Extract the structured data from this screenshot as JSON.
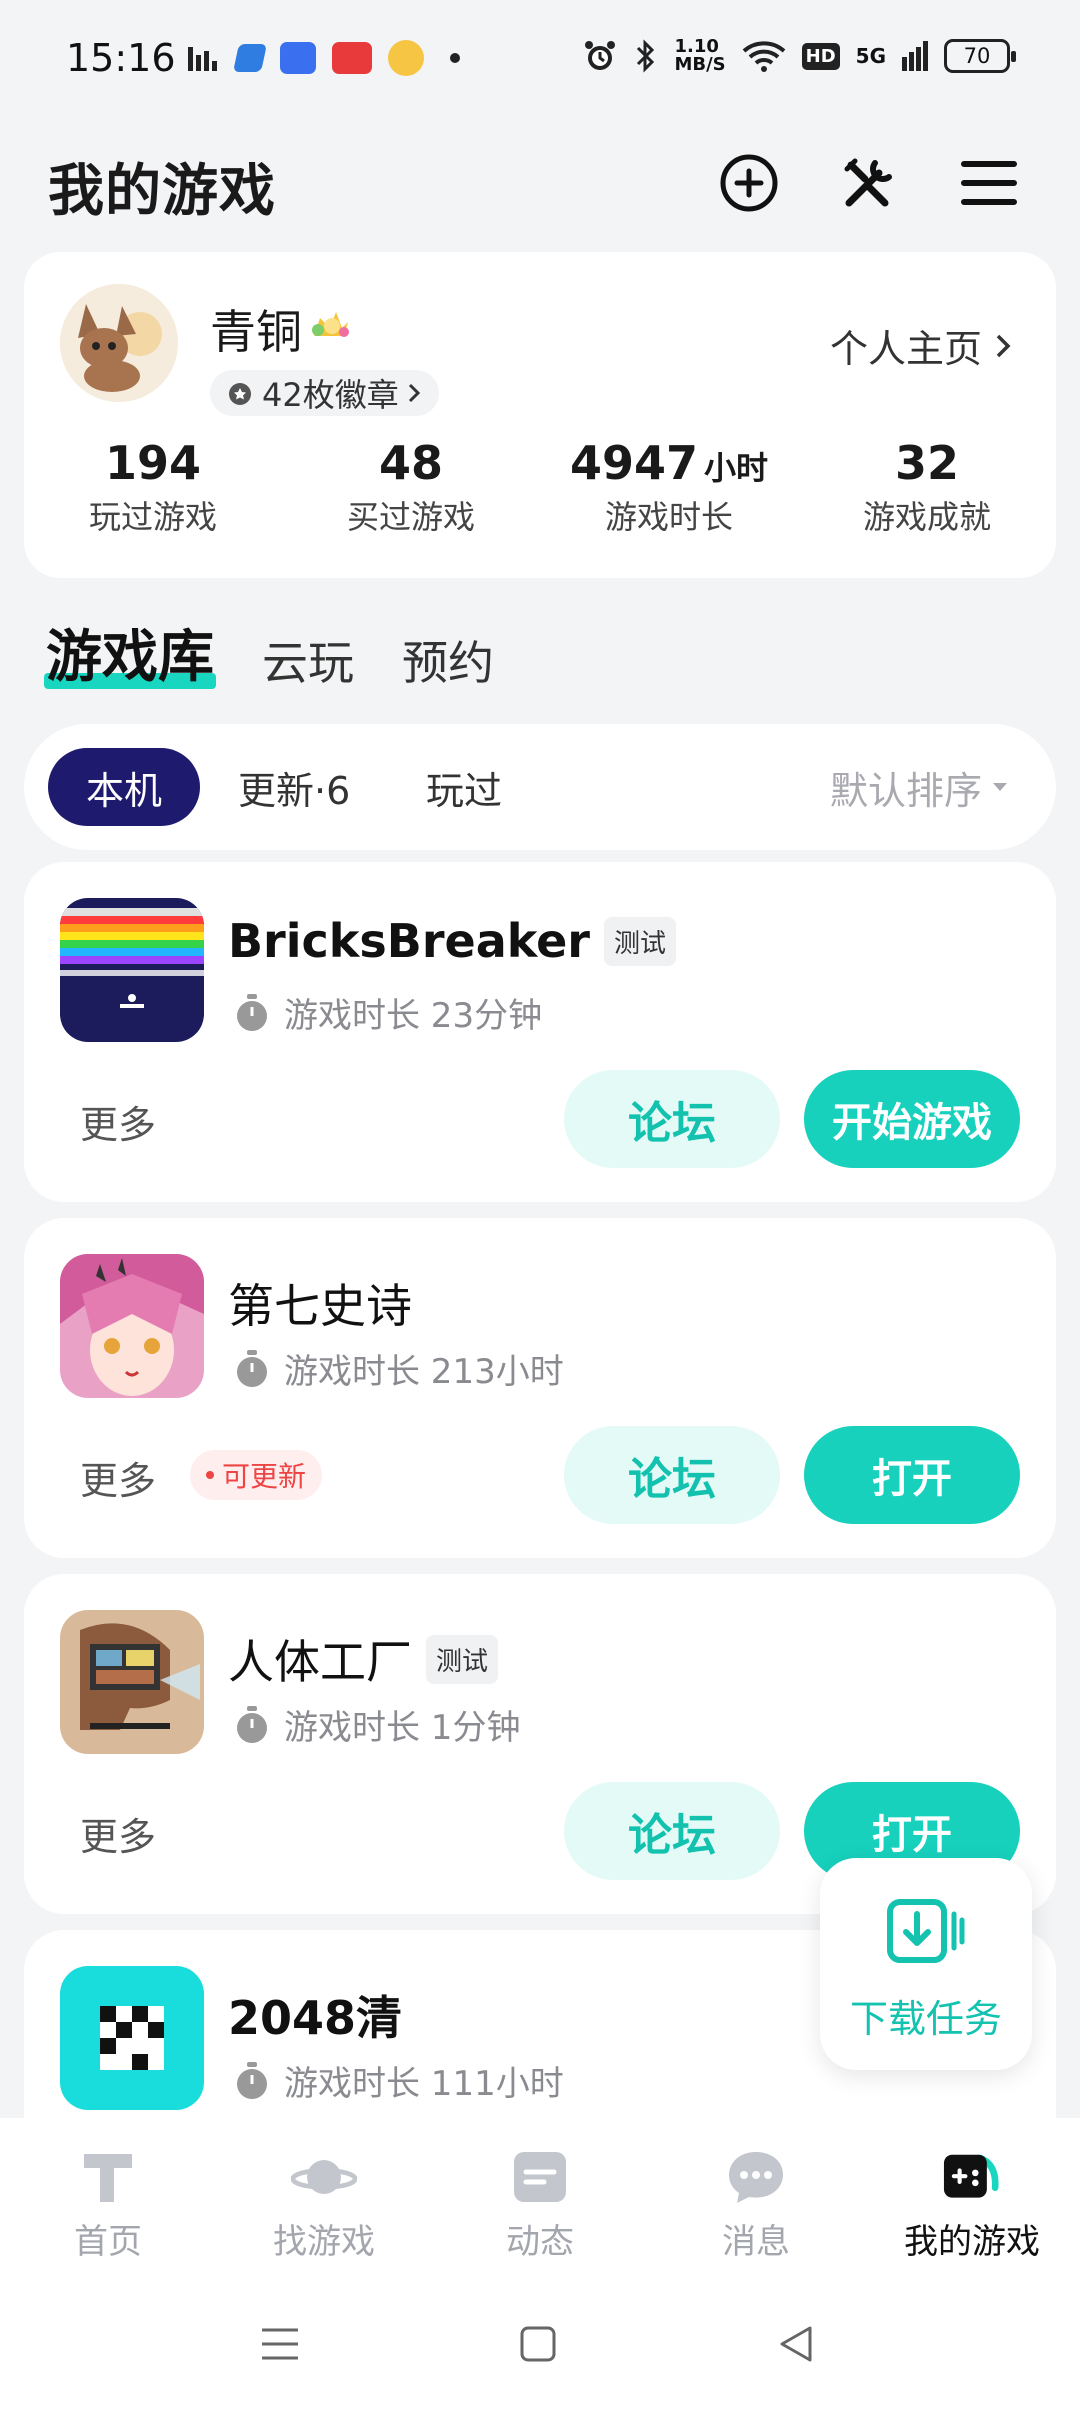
{
  "status_bar": {
    "time": "15:16",
    "speed": "1.10\nMB/S",
    "network": "5G",
    "battery": "70"
  },
  "header": {
    "title": "我的游戏",
    "add_icon": "plus-circle-icon",
    "tools_icon": "tools-icon",
    "menu_icon": "hamburger-menu-icon"
  },
  "profile": {
    "username": "青铜",
    "badges": "42枚徽章",
    "home_link": "个人主页",
    "stats": [
      {
        "value": "194",
        "unit": "",
        "label": "玩过游戏"
      },
      {
        "value": "48",
        "unit": "",
        "label": "买过游戏"
      },
      {
        "value": "4947",
        "unit": "小时",
        "label": "游戏时长"
      },
      {
        "value": "32",
        "unit": "",
        "label": "游戏成就"
      }
    ]
  },
  "section_tabs": [
    "游戏库",
    "云玩",
    "预约"
  ],
  "filters": {
    "items": [
      "本机",
      "更新·6",
      "玩过"
    ],
    "sort": "默认排序"
  },
  "games": [
    {
      "name": "BricksBreaker",
      "tag": "测试",
      "playtime": "游戏时长 23分钟",
      "more": "更多",
      "update": "",
      "forum": "论坛",
      "action": "开始游戏"
    },
    {
      "name": "第七史诗",
      "tag": "",
      "playtime": "游戏时长 213小时",
      "more": "更多",
      "update": "可更新",
      "forum": "论坛",
      "action": "打开"
    },
    {
      "name": "人体工厂",
      "tag": "测试",
      "playtime": "游戏时长 1分钟",
      "more": "更多",
      "update": "",
      "forum": "论坛",
      "action": "打开"
    },
    {
      "name": "2048清",
      "tag": "",
      "playtime": "游戏时长 111小时",
      "more": "",
      "update": "",
      "forum": "",
      "action": ""
    }
  ],
  "download_float": {
    "label": "下载任务"
  },
  "bottom_nav": [
    {
      "label": "首页",
      "icon": "home-icon"
    },
    {
      "label": "找游戏",
      "icon": "planet-icon"
    },
    {
      "label": "动态",
      "icon": "feed-icon"
    },
    {
      "label": "消息",
      "icon": "message-icon"
    },
    {
      "label": "我的游戏",
      "icon": "gamepad-icon"
    }
  ],
  "colors": {
    "accent": "#17d1bd",
    "active_filter": "#1e1a6e",
    "update_red": "#ee4444"
  }
}
